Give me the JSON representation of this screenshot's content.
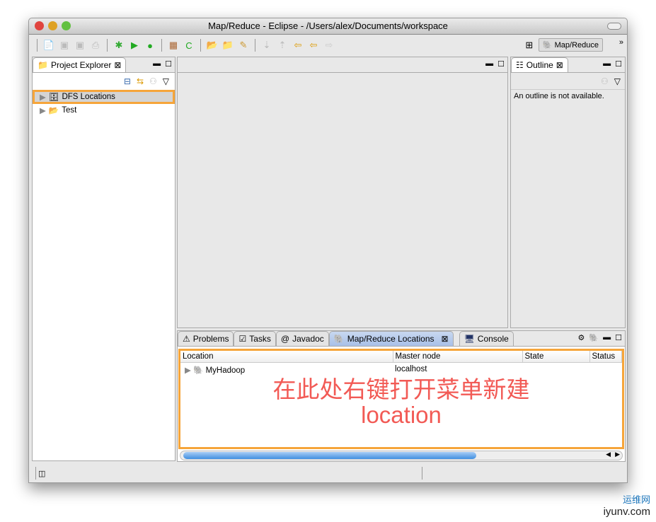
{
  "window": {
    "title": "Map/Reduce - Eclipse - /Users/alex/Documents/workspace"
  },
  "toolbar": {
    "perspective_label": "Map/Reduce",
    "more": "»"
  },
  "explorer": {
    "tab": "Project Explorer",
    "items": [
      {
        "label": "DFS Locations"
      },
      {
        "label": "Test"
      }
    ]
  },
  "outline": {
    "tab": "Outline",
    "message": "An outline is not available."
  },
  "bottom": {
    "tabs": [
      "Problems",
      "Tasks",
      "Javadoc",
      "Map/Reduce Locations",
      "Console"
    ],
    "columns": [
      "Location",
      "Master node",
      "State",
      "Status"
    ],
    "rows": [
      {
        "location": "MyHadoop",
        "master": "localhost",
        "state": "",
        "status": ""
      }
    ]
  },
  "annotation": {
    "line1": "在此处右键打开菜单新建",
    "line2": "location"
  },
  "watermark": {
    "cn": "运维网",
    "en": "iyunv.com"
  },
  "colors": {
    "highlight": "#f6a53a",
    "annotation": "#f25a55"
  }
}
